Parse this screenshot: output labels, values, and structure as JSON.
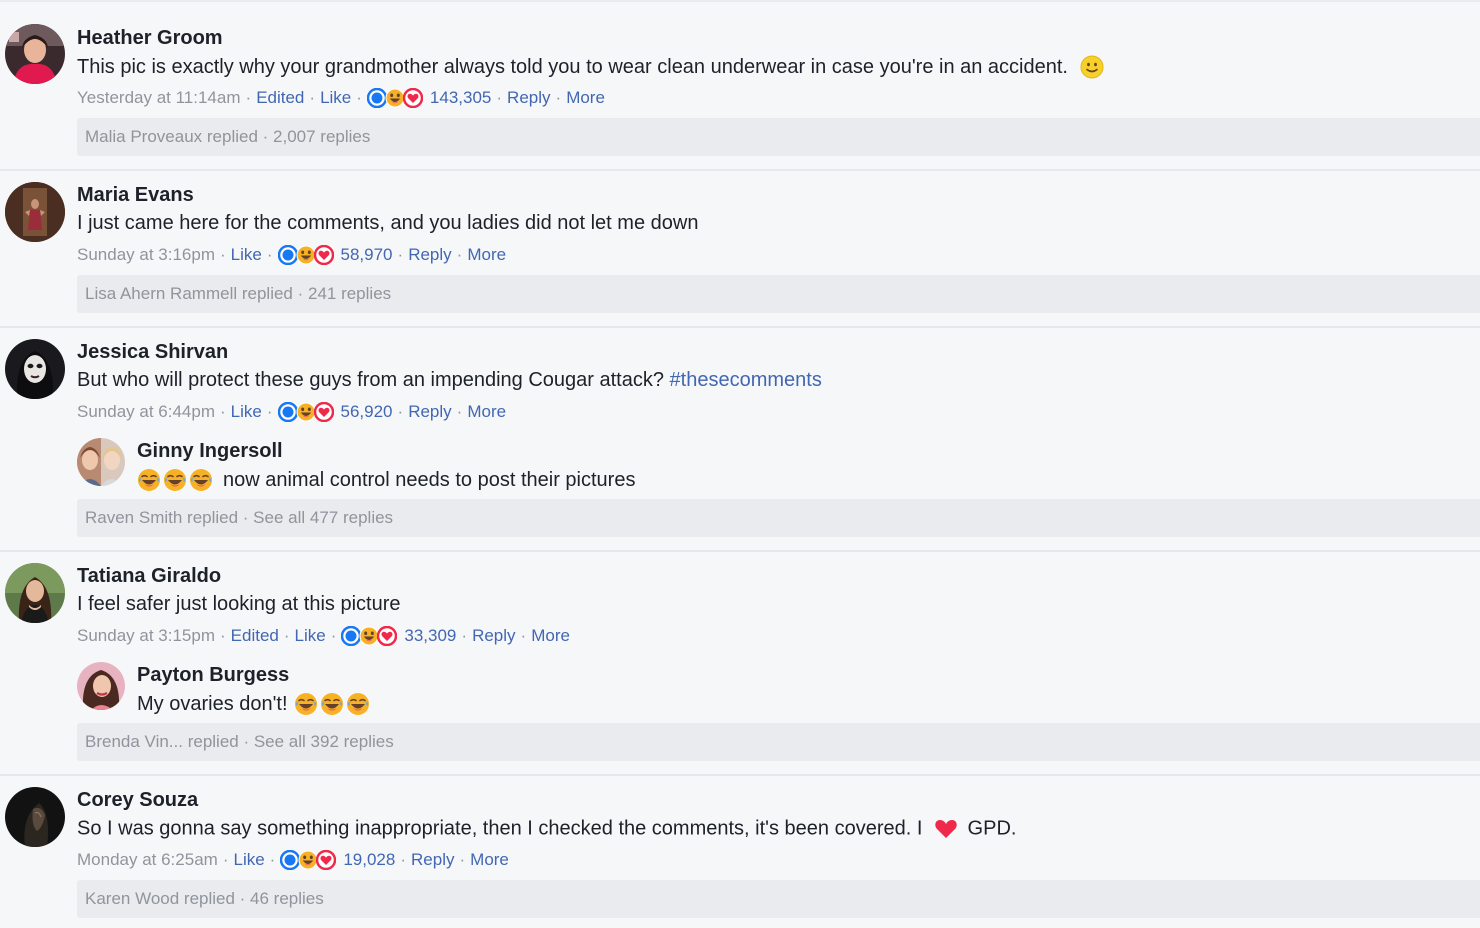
{
  "colors": {
    "background": "#f6f7f9",
    "link": "#4267b2",
    "meta_text": "#90949c",
    "body_text": "#1d2129",
    "reply_bar": "#e9ebee",
    "heart": "#f0284a",
    "haha": "#f7b125"
  },
  "comments": [
    {
      "author": "Heather Groom",
      "text": "This pic is exactly why your grandmother always told you to wear clean underwear in case you're in an accident.",
      "text_emoji": "smile-emoji-icon",
      "time": "Yesterday at 11:14am",
      "edited": "Edited",
      "like": "Like",
      "reaction_count": "143,305",
      "reply": "Reply",
      "more": "More",
      "replies_summary": "Malia Proveaux replied · 2,007 replies"
    },
    {
      "author": "Maria Evans",
      "text": "I just came here for the comments, and you ladies did not let me down",
      "time": "Sunday at 3:16pm",
      "like": "Like",
      "reaction_count": "58,970",
      "reply": "Reply",
      "more": "More",
      "replies_summary": "Lisa Ahern Rammell replied · 241 replies"
    },
    {
      "author": "Jessica Shirvan",
      "text": "But who will protect these guys from an impending Cougar attack?",
      "hashtag": "#thesecomments",
      "time": "Sunday at 6:44pm",
      "like": "Like",
      "reaction_count": "56,920",
      "reply": "Reply",
      "more": "More",
      "top_reply": {
        "author": "Ginny Ingersoll",
        "text": "now animal control needs to post their pictures",
        "emoji": "laughing-emoji-icon"
      },
      "replies_summary": "Raven Smith replied · See all 477 replies"
    },
    {
      "author": "Tatiana Giraldo",
      "text": "I feel safer just looking at this picture",
      "time": "Sunday at 3:15pm",
      "edited": "Edited",
      "like": "Like",
      "reaction_count": "33,309",
      "reply": "Reply",
      "more": "More",
      "top_reply": {
        "author": "Payton Burgess",
        "text": "My ovaries don't!",
        "emoji": "laughing-emoji-icon"
      },
      "replies_summary": "Brenda Vin... replied · See all 392 replies"
    },
    {
      "author": "Corey Souza",
      "text": "So I was gonna say something inappropriate, then I checked the comments, it's been covered. I",
      "text_emoji": "heart-emoji-icon",
      "text_after": "GPD.",
      "time": "Monday at 6:25am",
      "like": "Like",
      "reaction_count": "19,028",
      "reply": "Reply",
      "more": "More",
      "replies_summary": "Karen Wood replied · 46 replies"
    }
  ]
}
